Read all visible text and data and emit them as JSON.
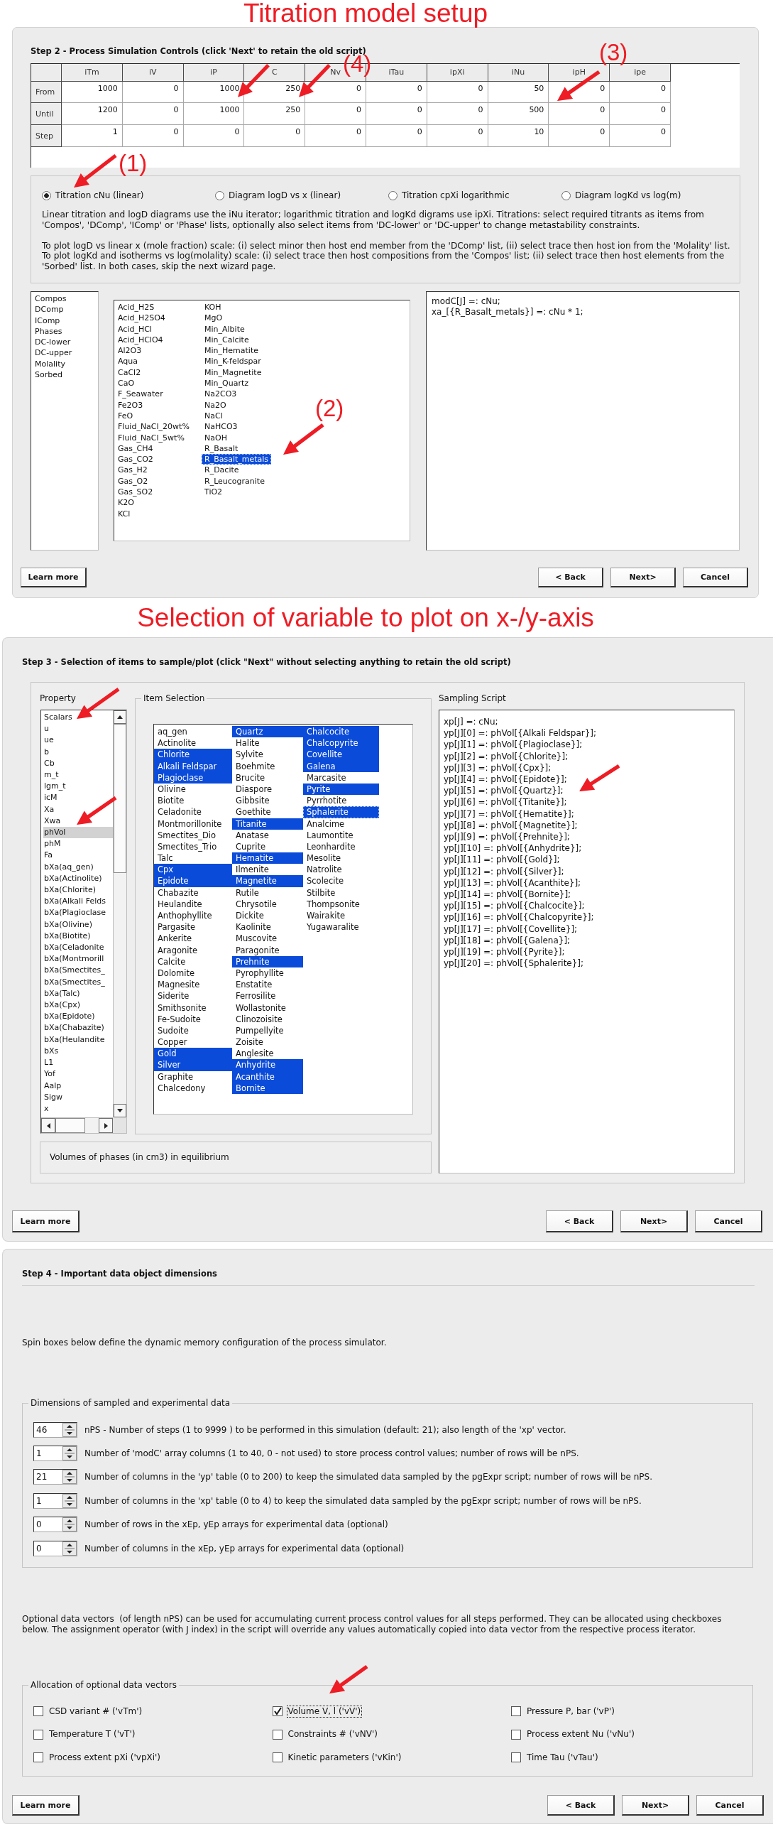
{
  "step2": {
    "caption": "Titration model setup",
    "heading": "Step 2 - Process Simulation Controls (click 'Next' to retain the old script)",
    "table": {
      "columns": [
        "iTm",
        "iV",
        "iP",
        "C",
        "Nv",
        "iTau",
        "ipXi",
        "iNu",
        "ipH",
        "ipe"
      ],
      "rows": [
        {
          "label": "From",
          "cells": [
            "1000",
            "0",
            "1000",
            "250",
            "0",
            "0",
            "0",
            "50",
            "0",
            "0"
          ]
        },
        {
          "label": "Until",
          "cells": [
            "1200",
            "0",
            "1000",
            "250",
            "0",
            "0",
            "0",
            "500",
            "0",
            "0"
          ]
        },
        {
          "label": "Step",
          "cells": [
            "1",
            "0",
            "0",
            "0",
            "0",
            "0",
            "0",
            "10",
            "0",
            "0"
          ]
        }
      ]
    },
    "modes": [
      {
        "label": "Titration cNu (linear)",
        "selected": true
      },
      {
        "label": "Diagram logD vs x (linear)",
        "selected": false
      },
      {
        "label": "Titration cpXi logarithmic",
        "selected": false
      },
      {
        "label": "Diagram logKd vs log(m)",
        "selected": false
      }
    ],
    "notes": [
      [
        "Linear titration and logD diagrams use the iNu iterator; logarithmic titration and logKd digrams use ipXi. Titrations: select required titrants as items from 'Compos', 'DComp', 'IComp' or 'Phase' lists, optionally also select items from 'DC-lower' or 'DC-upper' to change metastability constraints."
      ],
      [
        "To plot logD vs linear x (mole fraction) scale: (i) select minor then host end member from the 'DComp' list, (ii) select trace then host ion from the 'Molality' list.",
        "To plot logKd and isotherms vs log(molality) scale: (i) select trace then host compositions from the 'Compos' list; (ii) select trace then host elements from the 'Sorbed' list. In both cases, skip the next wizard page."
      ]
    ],
    "sources": [
      {
        "label": "Compos",
        "selected": false
      },
      {
        "label": "DComp",
        "selected": false
      },
      {
        "label": "IComp",
        "selected": false
      },
      {
        "label": "Phases",
        "selected": false
      },
      {
        "label": "DC-lower",
        "selected": false
      },
      {
        "label": "DC-upper",
        "selected": false
      },
      {
        "label": "Molality",
        "selected": false
      },
      {
        "label": "Sorbed",
        "selected": false
      }
    ],
    "items": [
      {
        "label": "Acid_H2S",
        "selected": false,
        "focused": false
      },
      {
        "label": "Acid_H2SO4",
        "selected": false,
        "focused": false
      },
      {
        "label": "Acid_HCl",
        "selected": false,
        "focused": false
      },
      {
        "label": "Acid_HClO4",
        "selected": false,
        "focused": false
      },
      {
        "label": "Al2O3",
        "selected": false,
        "focused": false
      },
      {
        "label": "Aqua",
        "selected": false,
        "focused": false
      },
      {
        "label": "CaCl2",
        "selected": false,
        "focused": false
      },
      {
        "label": "CaO",
        "selected": false,
        "focused": false
      },
      {
        "label": "F_Seawater",
        "selected": false,
        "focused": false
      },
      {
        "label": "Fe2O3",
        "selected": false,
        "focused": false
      },
      {
        "label": "FeO",
        "selected": false,
        "focused": false
      },
      {
        "label": "Fluid_NaCl_20wt%",
        "selected": false,
        "focused": false
      },
      {
        "label": "Fluid_NaCl_5wt%",
        "selected": false,
        "focused": false
      },
      {
        "label": "Gas_CH4",
        "selected": false,
        "focused": false
      },
      {
        "label": "Gas_CO2",
        "selected": false,
        "focused": false
      },
      {
        "label": "Gas_H2",
        "selected": false,
        "focused": false
      },
      {
        "label": "Gas_O2",
        "selected": false,
        "focused": false
      },
      {
        "label": "Gas_SO2",
        "selected": false,
        "focused": false
      },
      {
        "label": "K2O",
        "selected": false,
        "focused": false
      },
      {
        "label": "KCl",
        "selected": false,
        "focused": false
      },
      {
        "label": "KOH",
        "selected": false,
        "focused": false
      },
      {
        "label": "MgO",
        "selected": false,
        "focused": false
      },
      {
        "label": "Min_Albite",
        "selected": false,
        "focused": false
      },
      {
        "label": "Min_Calcite",
        "selected": false,
        "focused": false
      },
      {
        "label": "Min_Hematite",
        "selected": false,
        "focused": false
      },
      {
        "label": "Min_K-feldspar",
        "selected": false,
        "focused": false
      },
      {
        "label": "Min_Magnetite",
        "selected": false,
        "focused": false
      },
      {
        "label": "Min_Quartz",
        "selected": false,
        "focused": false
      },
      {
        "label": "Na2CO3",
        "selected": false,
        "focused": false
      },
      {
        "label": "Na2O",
        "selected": false,
        "focused": false
      },
      {
        "label": "NaCl",
        "selected": false,
        "focused": false
      },
      {
        "label": "NaHCO3",
        "selected": false,
        "focused": false
      },
      {
        "label": "NaOH",
        "selected": false,
        "focused": false
      },
      {
        "label": "R_Basalt",
        "selected": false,
        "focused": false
      },
      {
        "label": "R_Basalt_metals",
        "selected": true,
        "focused": true
      },
      {
        "label": "R_Dacite",
        "selected": false,
        "focused": false
      },
      {
        "label": "R_Leucogranite",
        "selected": false,
        "focused": false
      },
      {
        "label": "TiO2",
        "selected": false,
        "focused": false
      }
    ],
    "script": [
      "modC[J] =: cNu;",
      "xa_[{R_Basalt_metals}] =: cNu * 1;"
    ],
    "callouts": [
      "(1)",
      "(2)",
      "(3)",
      "(4)"
    ],
    "help_button": "Learn more",
    "nav_buttons": [
      "< Back",
      "Next>",
      "Cancel"
    ]
  },
  "step3": {
    "caption": "Selection of variable to plot on x-/y-axis",
    "heading": "Step 3 - Selection of items to sample/plot (click \"Next\" without selecting anything to retain the old script)",
    "property": {
      "title": "Property",
      "items": [
        {
          "label": "Scalars",
          "selected": false
        },
        {
          "label": "u",
          "selected": false
        },
        {
          "label": "ue",
          "selected": false
        },
        {
          "label": "b",
          "selected": false
        },
        {
          "label": "Cb",
          "selected": false
        },
        {
          "label": "m_t",
          "selected": false
        },
        {
          "label": "lgm_t",
          "selected": false
        },
        {
          "label": "icM",
          "selected": false
        },
        {
          "label": "Xa",
          "selected": false
        },
        {
          "label": "Xwa",
          "selected": false
        },
        {
          "label": "phVol",
          "selected": true
        },
        {
          "label": "phM",
          "selected": false
        },
        {
          "label": "Fa",
          "selected": false
        },
        {
          "label": "bXa(aq_gen)",
          "selected": false
        },
        {
          "label": "bXa(Actinolite)",
          "selected": false
        },
        {
          "label": "bXa(Chlorite)",
          "selected": false
        },
        {
          "label": "bXa(Alkali Felds",
          "selected": false
        },
        {
          "label": "bXa(Plagioclase",
          "selected": false
        },
        {
          "label": "bXa(Olivine)",
          "selected": false
        },
        {
          "label": "bXa(Biotite)",
          "selected": false
        },
        {
          "label": "bXa(Celadonite",
          "selected": false
        },
        {
          "label": "bXa(Montmorill",
          "selected": false
        },
        {
          "label": "bXa(Smectites_",
          "selected": false
        },
        {
          "label": "bXa(Smectites_",
          "selected": false
        },
        {
          "label": "bXa(Talc)",
          "selected": false
        },
        {
          "label": "bXa(Cpx)",
          "selected": false
        },
        {
          "label": "bXa(Epidote)",
          "selected": false
        },
        {
          "label": "bXa(Chabazite)",
          "selected": false
        },
        {
          "label": "bXa(Heulandite",
          "selected": false
        },
        {
          "label": "bXs",
          "selected": false
        },
        {
          "label": "L1",
          "selected": false
        },
        {
          "label": "Yof",
          "selected": false
        },
        {
          "label": "Aalp",
          "selected": false
        },
        {
          "label": "Sigw",
          "selected": false
        },
        {
          "label": "x",
          "selected": false
        }
      ]
    },
    "item_selection": {
      "title": "Item Selection",
      "items": [
        {
          "label": "aq_gen",
          "selected": false,
          "focused": false
        },
        {
          "label": "Actinolite",
          "selected": false,
          "focused": false
        },
        {
          "label": "Chlorite",
          "selected": true,
          "focused": false
        },
        {
          "label": "Alkali Feldspar",
          "selected": true,
          "focused": false
        },
        {
          "label": "Plagioclase",
          "selected": true,
          "focused": false
        },
        {
          "label": "Olivine",
          "selected": false,
          "focused": false
        },
        {
          "label": "Biotite",
          "selected": false,
          "focused": false
        },
        {
          "label": "Celadonite",
          "selected": false,
          "focused": false
        },
        {
          "label": "Montmorillonite",
          "selected": false,
          "focused": false
        },
        {
          "label": "Smectites_Dio",
          "selected": false,
          "focused": false
        },
        {
          "label": "Smectites_Trio",
          "selected": false,
          "focused": false
        },
        {
          "label": "Talc",
          "selected": false,
          "focused": false
        },
        {
          "label": "Cpx",
          "selected": true,
          "focused": false
        },
        {
          "label": "Epidote",
          "selected": true,
          "focused": false
        },
        {
          "label": "Chabazite",
          "selected": false,
          "focused": false
        },
        {
          "label": "Heulandite",
          "selected": false,
          "focused": false
        },
        {
          "label": "Anthophyllite",
          "selected": false,
          "focused": false
        },
        {
          "label": "Pargasite",
          "selected": false,
          "focused": false
        },
        {
          "label": "Ankerite",
          "selected": false,
          "focused": false
        },
        {
          "label": "Aragonite",
          "selected": false,
          "focused": false
        },
        {
          "label": "Calcite",
          "selected": false,
          "focused": false
        },
        {
          "label": "Dolomite",
          "selected": false,
          "focused": false
        },
        {
          "label": "Magnesite",
          "selected": false,
          "focused": false
        },
        {
          "label": "Siderite",
          "selected": false,
          "focused": false
        },
        {
          "label": "Smithsonite",
          "selected": false,
          "focused": false
        },
        {
          "label": "Fe-Sudoite",
          "selected": false,
          "focused": false
        },
        {
          "label": "Sudoite",
          "selected": false,
          "focused": false
        },
        {
          "label": "Copper",
          "selected": false,
          "focused": false
        },
        {
          "label": "Gold",
          "selected": true,
          "focused": false
        },
        {
          "label": "Silver",
          "selected": true,
          "focused": false
        },
        {
          "label": "Graphite",
          "selected": false,
          "focused": false
        },
        {
          "label": "Chalcedony",
          "selected": false,
          "focused": false
        },
        {
          "label": "Quartz",
          "selected": true,
          "focused": false
        },
        {
          "label": "Halite",
          "selected": false,
          "focused": false
        },
        {
          "label": "Sylvite",
          "selected": false,
          "focused": false
        },
        {
          "label": "Boehmite",
          "selected": false,
          "focused": false
        },
        {
          "label": "Brucite",
          "selected": false,
          "focused": false
        },
        {
          "label": "Diaspore",
          "selected": false,
          "focused": false
        },
        {
          "label": "Gibbsite",
          "selected": false,
          "focused": false
        },
        {
          "label": "Goethite",
          "selected": false,
          "focused": false
        },
        {
          "label": "Titanite",
          "selected": true,
          "focused": false
        },
        {
          "label": "Anatase",
          "selected": false,
          "focused": false
        },
        {
          "label": "Cuprite",
          "selected": false,
          "focused": false
        },
        {
          "label": "Hematite",
          "selected": true,
          "focused": false
        },
        {
          "label": "Ilmenite",
          "selected": false,
          "focused": false
        },
        {
          "label": "Magnetite",
          "selected": true,
          "focused": false
        },
        {
          "label": "Rutile",
          "selected": false,
          "focused": false
        },
        {
          "label": "Chrysotile",
          "selected": false,
          "focused": false
        },
        {
          "label": "Dickite",
          "selected": false,
          "focused": false
        },
        {
          "label": "Kaolinite",
          "selected": false,
          "focused": false
        },
        {
          "label": "Muscovite",
          "selected": false,
          "focused": false
        },
        {
          "label": "Paragonite",
          "selected": false,
          "focused": false
        },
        {
          "label": "Prehnite",
          "selected": true,
          "focused": false
        },
        {
          "label": "Pyrophyllite",
          "selected": false,
          "focused": false
        },
        {
          "label": "Enstatite",
          "selected": false,
          "focused": false
        },
        {
          "label": "Ferrosilite",
          "selected": false,
          "focused": false
        },
        {
          "label": "Wollastonite",
          "selected": false,
          "focused": false
        },
        {
          "label": "Clinozoisite",
          "selected": false,
          "focused": false
        },
        {
          "label": "Pumpellyite",
          "selected": false,
          "focused": false
        },
        {
          "label": "Zoisite",
          "selected": false,
          "focused": false
        },
        {
          "label": "Anglesite",
          "selected": false,
          "focused": false
        },
        {
          "label": "Anhydrite",
          "selected": true,
          "focused": false
        },
        {
          "label": "Acanthite",
          "selected": true,
          "focused": false
        },
        {
          "label": "Bornite",
          "selected": true,
          "focused": false
        },
        {
          "label": "Chalcocite",
          "selected": true,
          "focused": false
        },
        {
          "label": "Chalcopyrite",
          "selected": true,
          "focused": false
        },
        {
          "label": "Covellite",
          "selected": true,
          "focused": false
        },
        {
          "label": "Galena",
          "selected": true,
          "focused": false
        },
        {
          "label": "Marcasite",
          "selected": false,
          "focused": false
        },
        {
          "label": "Pyrite",
          "selected": true,
          "focused": false
        },
        {
          "label": "Pyrrhotite",
          "selected": false,
          "focused": false
        },
        {
          "label": "Sphalerite",
          "selected": true,
          "focused": true
        },
        {
          "label": "Analcime",
          "selected": false,
          "focused": false
        },
        {
          "label": "Laumontite",
          "selected": false,
          "focused": false
        },
        {
          "label": "Leonhardite",
          "selected": false,
          "focused": false
        },
        {
          "label": "Mesolite",
          "selected": false,
          "focused": false
        },
        {
          "label": "Natrolite",
          "selected": false,
          "focused": false
        },
        {
          "label": "Scolecite",
          "selected": false,
          "focused": false
        },
        {
          "label": "Stilbite",
          "selected": false,
          "focused": false
        },
        {
          "label": "Thompsonite",
          "selected": false,
          "focused": false
        },
        {
          "label": "Wairakite",
          "selected": false,
          "focused": false
        },
        {
          "label": "Yugawaralite",
          "selected": false,
          "focused": false
        }
      ]
    },
    "description": "Volumes of phases (in cm3) in equilibrium",
    "script": {
      "title": "Sampling Script",
      "lines": [
        "xp[J] =: cNu;",
        "yp[J][0] =: phVol[{Alkali Feldspar}];",
        "yp[J][1] =: phVol[{Plagioclase}];",
        "yp[J][2] =: phVol[{Chlorite}];",
        "yp[J][3] =: phVol[{Cpx}];",
        "yp[J][4] =: phVol[{Epidote}];",
        "yp[J][5] =: phVol[{Quartz}];",
        "yp[J][6] =: phVol[{Titanite}];",
        "yp[J][7] =: phVol[{Hematite}];",
        "yp[J][8] =: phVol[{Magnetite}];",
        "yp[J][9] =: phVol[{Prehnite}];",
        "yp[J][10] =: phVol[{Anhydrite}];",
        "yp[J][11] =: phVol[{Gold}];",
        "yp[J][12] =: phVol[{Silver}];",
        "yp[J][13] =: phVol[{Acanthite}];",
        "yp[J][14] =: phVol[{Bornite}];",
        "yp[J][15] =: phVol[{Chalcocite}];",
        "yp[J][16] =: phVol[{Chalcopyrite}];",
        "yp[J][17] =: phVol[{Covellite}];",
        "yp[J][18] =: phVol[{Galena}];",
        "yp[J][19] =: phVol[{Pyrite}];",
        "yp[J][20] =: phVol[{Sphalerite}];"
      ]
    },
    "help_button": "Learn more",
    "nav_buttons": [
      "< Back",
      "Next>",
      "Cancel"
    ]
  },
  "step4": {
    "heading": "Step 4 - Important data object dimensions",
    "intro": "Spin boxes below define the dynamic memory configuration of the process simulator.",
    "dimensions": {
      "title": "Dimensions of sampled and experimental data",
      "rows": [
        {
          "value": "46",
          "label": "nPS - Number of steps (1 to 9999 ) to be performed in this simulation (default: 21); also length of the 'xp' vector."
        },
        {
          "value": "1",
          "label": "Number of 'modC' array columns (1 to 40, 0 - not used) to store process control values; number of rows will be nPS."
        },
        {
          "value": "21",
          "label": "Number of columns in the 'yp' table (0 to 200) to keep the simulated data sampled by the pgExpr script; number of rows will be nPS."
        },
        {
          "value": "1",
          "label": "Number of columns in the 'xp' table (0 to 4) to keep the simulated data sampled by the pgExpr script; number of rows will be nPS."
        },
        {
          "value": "0",
          "label": "Number of rows in the xEp, yEp arrays for experimental data (optional)"
        },
        {
          "value": "0",
          "label": "Number of columns in the xEp, yEp arrays for experimental data (optional)"
        }
      ]
    },
    "vectors_note": "Optional data vectors  (of length nPS) can be used for accumulating current process control values for all steps performed. They can be allocated using checkboxes below. The assignment operator (with J index) in the script will override any values automatically copied into data vector from the respective process iterator.",
    "allocation": {
      "title": "Allocation of optional data vectors",
      "options": [
        {
          "label": "CSD variant # ('vTm')",
          "checked": false,
          "focused": false
        },
        {
          "label": "Volume V, l ('vV')",
          "checked": true,
          "focused": true
        },
        {
          "label": "Pressure P, bar ('vP')",
          "checked": false,
          "focused": false
        },
        {
          "label": "Temperature T ('vT')",
          "checked": false,
          "focused": false
        },
        {
          "label": "Constraints # ('vNV')",
          "checked": false,
          "focused": false
        },
        {
          "label": "Process extent Nu ('vNu')",
          "checked": false,
          "focused": false
        },
        {
          "label": "Process extent pXi ('vpXi')",
          "checked": false,
          "focused": false
        },
        {
          "label": "Kinetic parameters ('vKin')",
          "checked": false,
          "focused": false
        },
        {
          "label": "Time Tau ('vTau')",
          "checked": false,
          "focused": false
        }
      ]
    },
    "help_button": "Learn more",
    "nav_buttons": [
      "< Back",
      "Next>",
      "Cancel"
    ]
  }
}
